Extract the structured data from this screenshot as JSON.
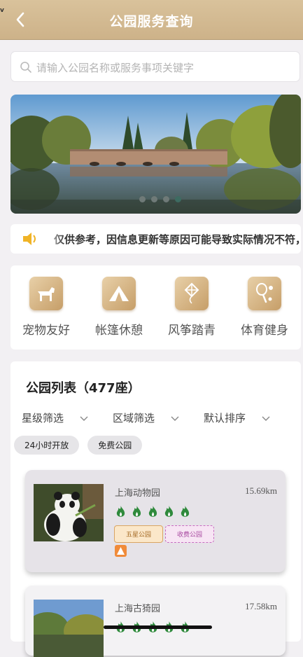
{
  "header": {
    "title": "公园服务查询",
    "corner_tag": "v"
  },
  "search": {
    "placeholder": "请输入公园名称或服务事项关键字"
  },
  "banner": {
    "slides": 4,
    "active_slide": 4
  },
  "notice": {
    "text": "仅供参考，因信息更新等原因可能导致实际情况不符，"
  },
  "categories": [
    {
      "label": "宠物友好",
      "icon": "dog-icon"
    },
    {
      "label": "帐篷休憩",
      "icon": "tent-icon"
    },
    {
      "label": "风筝踏青",
      "icon": "kite-icon"
    },
    {
      "label": "体育健身",
      "icon": "racket-icon"
    }
  ],
  "park_list": {
    "title": "公园列表（477座）",
    "filters": [
      "星级筛选",
      "区域筛选",
      "默认排序"
    ],
    "chips": [
      "24小时开放",
      "免费公园"
    ],
    "items": [
      {
        "name": "上海动物园",
        "distance": "15.69km",
        "rating": 5,
        "tags": [
          "五星公园",
          "收费公园"
        ]
      },
      {
        "name": "上海古猗园",
        "distance": "17.58km",
        "rating": 5,
        "tags": []
      }
    ]
  },
  "colors": {
    "header": "#d4bb93",
    "accent_brown": "#c69e68",
    "flame": "#2f8a3c"
  }
}
